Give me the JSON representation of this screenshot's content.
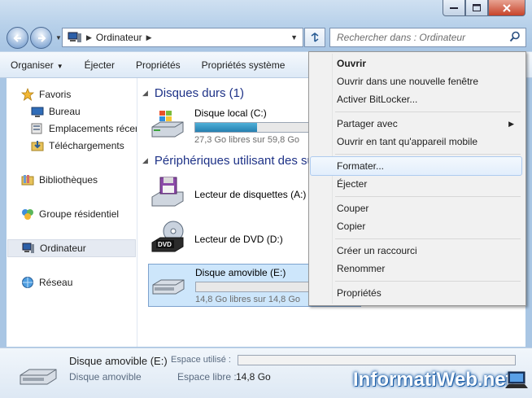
{
  "address_bar": {
    "location": "Ordinateur"
  },
  "search": {
    "placeholder": "Rechercher dans : Ordinateur"
  },
  "toolbar": {
    "organize": "Organiser",
    "eject": "Éjecter",
    "properties": "Propriétés",
    "system_properties": "Propriétés système"
  },
  "sidebar": {
    "favorites": "Favoris",
    "desktop": "Bureau",
    "recent_places": "Emplacements récer",
    "downloads": "Téléchargements",
    "libraries": "Bibliothèques",
    "homegroup": "Groupe résidentiel",
    "computer": "Ordinateur",
    "network": "Réseau"
  },
  "content": {
    "hard_disks_header": "Disques durs (1)",
    "removable_header": "Périphériques utilisant des su",
    "drives": [
      {
        "name": "Disque local (C:)",
        "free": "27,3 Go libres sur 59,8 Go",
        "used_fraction": 0.54
      },
      {
        "name": "Lecteur de disquettes (A:)"
      },
      {
        "name": "Lecteur de DVD (D:)"
      },
      {
        "name": "Disque amovible (E:)",
        "free": "14,8 Go libres sur 14,8 Go",
        "used_fraction": 0.0
      }
    ]
  },
  "context_menu": {
    "items": [
      "Ouvrir",
      "Ouvrir dans une nouvelle fenêtre",
      "Activer BitLocker...",
      "Partager avec",
      "Ouvrir en tant qu'appareil mobile",
      "Formater...",
      "Éjecter",
      "Couper",
      "Copier",
      "Créer un raccourci",
      "Renommer",
      "Propriétés"
    ]
  },
  "details": {
    "name": "Disque amovible (E:)",
    "type": "Disque amovible",
    "used_label": "Espace utilisé :",
    "free_label": "Espace libre :",
    "free_value": "14,8 Go"
  },
  "watermark": "InformatiWeb.net",
  "colors": {
    "accent": "#1e3287",
    "bar_fill": "#2680b0",
    "selection": "#cde6fb"
  }
}
